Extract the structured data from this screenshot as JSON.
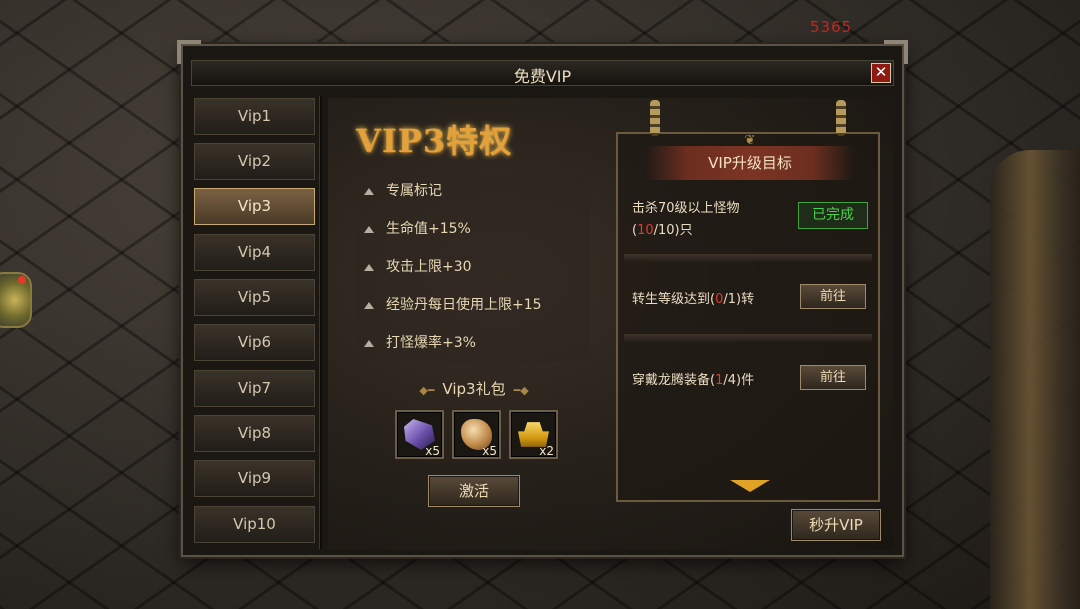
{
  "hud": {
    "score": "5365"
  },
  "window": {
    "title": "免费VIP",
    "close_label": "✕"
  },
  "tabs": [
    {
      "label": "Vip1"
    },
    {
      "label": "Vip2"
    },
    {
      "label": "Vip3",
      "active": true
    },
    {
      "label": "Vip4"
    },
    {
      "label": "Vip5"
    },
    {
      "label": "Vip6"
    },
    {
      "label": "Vip7"
    },
    {
      "label": "Vip8"
    },
    {
      "label": "Vip9"
    },
    {
      "label": "Vip10"
    }
  ],
  "privileges": {
    "title": "VIP3特权",
    "items": [
      "专属标记",
      "生命值+15%",
      "攻击上限+30",
      "经验丹每日使用上限+15",
      "打怪爆率+3%"
    ]
  },
  "gift": {
    "title": "Vip3礼包",
    "items": [
      {
        "icon": "crystal-icon",
        "count": "x5"
      },
      {
        "icon": "ore-icon",
        "count": "x5"
      },
      {
        "icon": "gold-ingot-icon",
        "count": "x2"
      }
    ],
    "activate_label": "激活"
  },
  "upgrade": {
    "title": "VIP升级目标",
    "tasks": [
      {
        "text_a": "击杀70级以上怪物",
        "line2_pre": "(",
        "progress": "10",
        "line2_post": "/10)只",
        "status": "已完成"
      },
      {
        "text_pre": "转生等级达到(",
        "progress": "0",
        "text_post": "/1)转",
        "action": "前往"
      },
      {
        "text_pre": "穿戴龙腾装备(",
        "progress": "1",
        "text_post": "/4)件",
        "action": "前往"
      }
    ],
    "instant_label": "秒升VIP"
  },
  "colors": {
    "accent_gold": "#e2a13a",
    "progress_red": "#e23a2a",
    "done_green": "#4ad24a"
  }
}
